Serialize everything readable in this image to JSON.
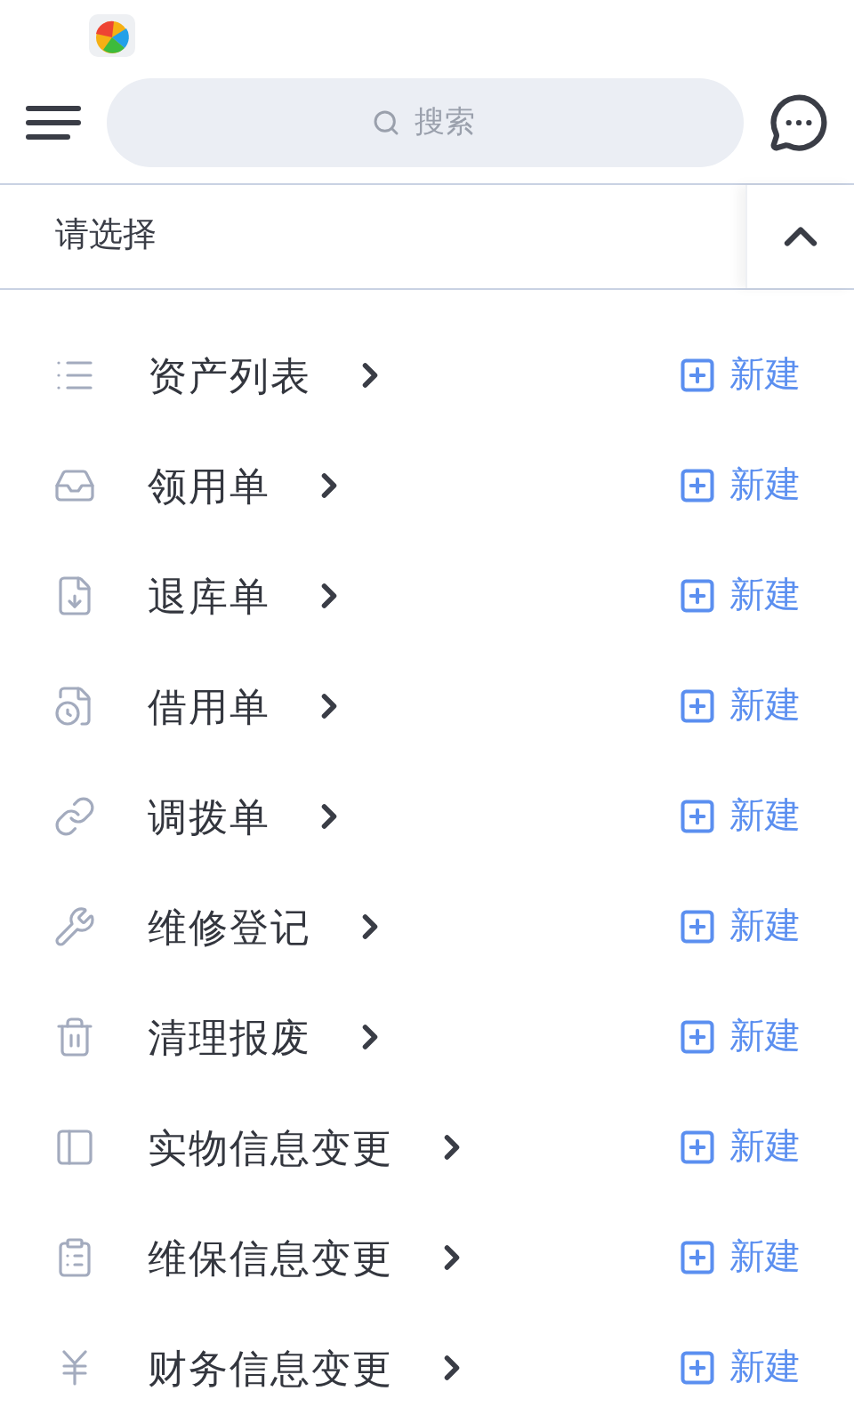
{
  "search": {
    "placeholder": "搜索"
  },
  "selector": {
    "label": "请选择",
    "expanded": true
  },
  "items": [
    {
      "kind": "list",
      "label": "资产列表",
      "action": "新建"
    },
    {
      "kind": "tray",
      "label": "领用单",
      "action": "新建"
    },
    {
      "kind": "download",
      "label": "退库单",
      "action": "新建"
    },
    {
      "kind": "clock-doc",
      "label": "借用单",
      "action": "新建"
    },
    {
      "kind": "link",
      "label": "调拨单",
      "action": "新建"
    },
    {
      "kind": "wrench",
      "label": "维修登记",
      "action": "新建"
    },
    {
      "kind": "trash",
      "label": "清理报废",
      "action": "新建"
    },
    {
      "kind": "layout",
      "label": "实物信息变更",
      "action": "新建"
    },
    {
      "kind": "clipboard",
      "label": "维保信息变更",
      "action": "新建"
    },
    {
      "kind": "yen",
      "label": "财务信息变更",
      "action": "新建"
    }
  ]
}
